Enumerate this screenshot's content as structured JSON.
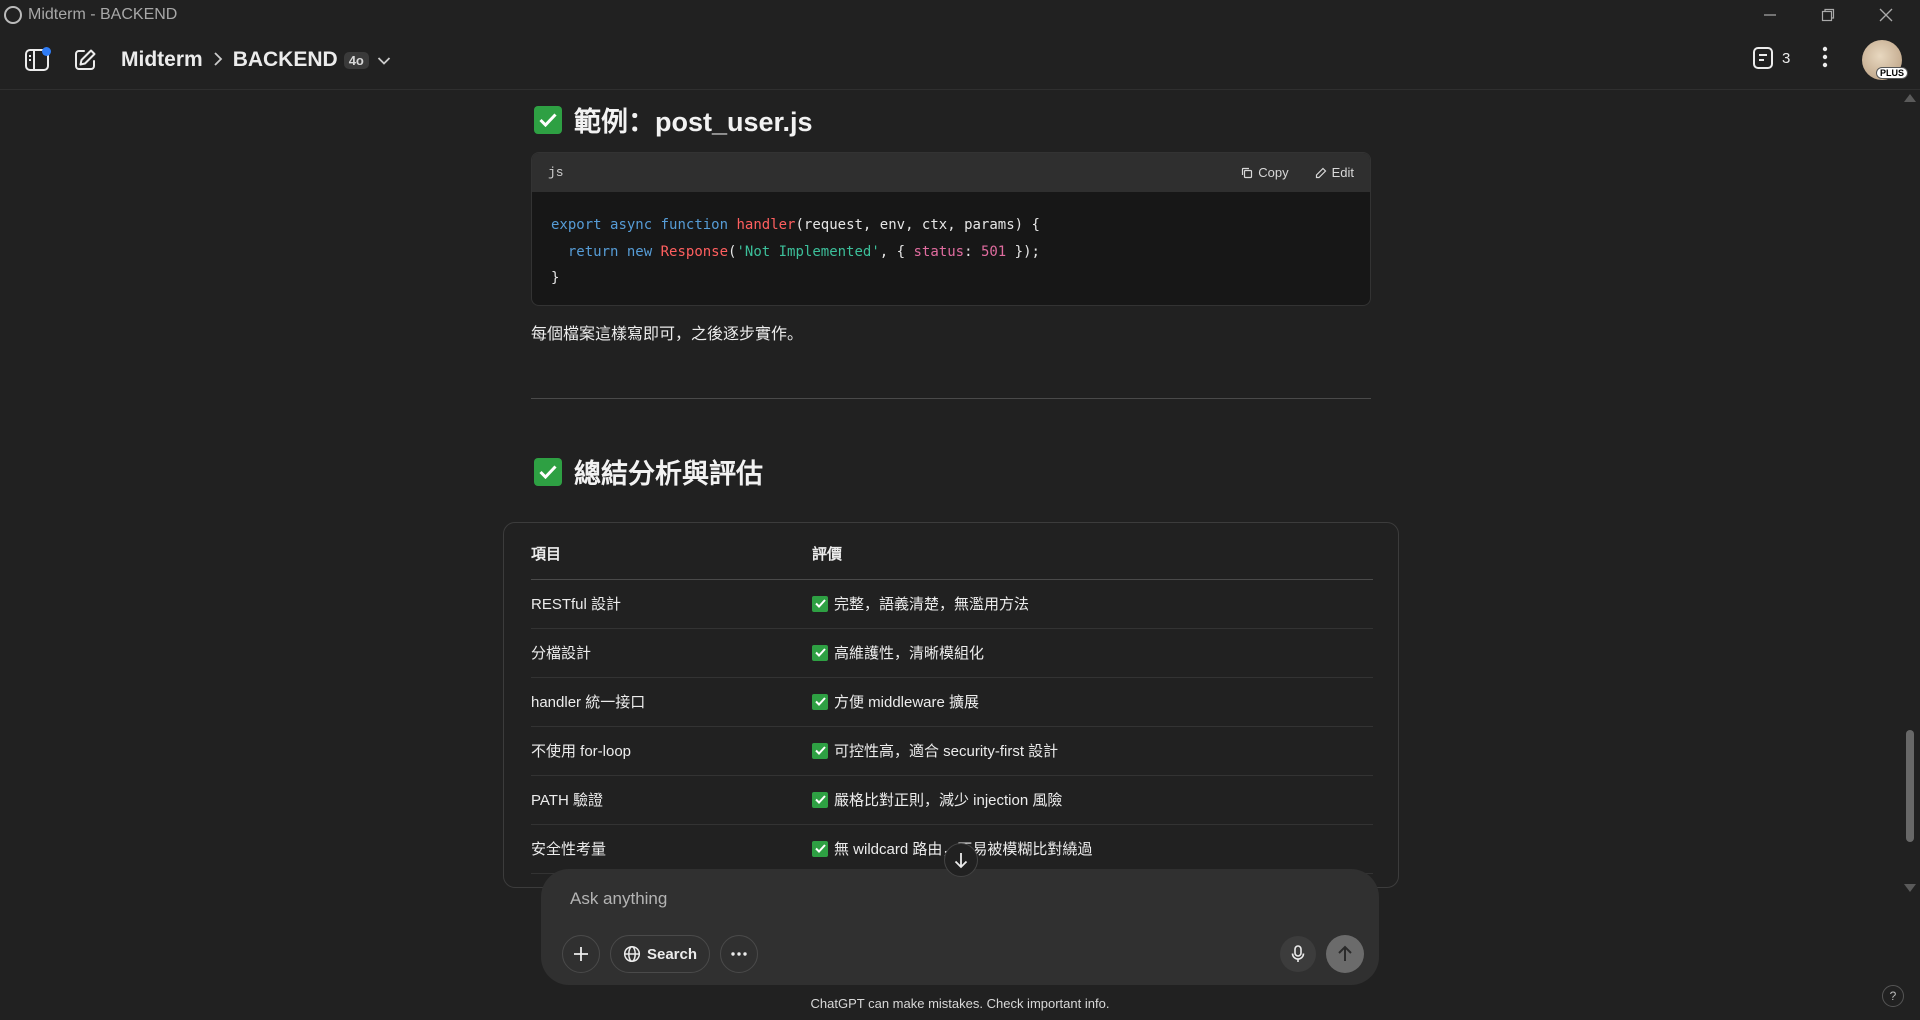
{
  "window": {
    "title": "Midterm - BACKEND"
  },
  "header": {
    "project": "Midterm",
    "chat": "BACKEND",
    "model_badge": "4o",
    "docs_count": "3",
    "plan_badge": "PLUS"
  },
  "section1": {
    "heading": "範例：post_user.js",
    "code": {
      "lang": "js",
      "copy_label": "Copy",
      "edit_label": "Edit",
      "line1": {
        "t1": "export",
        "t2": "async",
        "t3": "function",
        "t4": "handler",
        "t5": "(request, env, ctx, params) {"
      },
      "line2": {
        "t1": "return",
        "t2": "new",
        "t3": "Response",
        "t4": "(",
        "t5": "'Not Implemented'",
        "t6": ", { ",
        "t7": "status",
        "t8": ": ",
        "t9": "501",
        "t10": " });"
      },
      "line3": "}"
    },
    "note": "每個檔案這樣寫即可，之後逐步實作。"
  },
  "section2": {
    "heading": "總結分析與評估",
    "table": {
      "headers": [
        "項目",
        "評價"
      ],
      "rows": [
        {
          "item": "RESTful 設計",
          "eval": "完整，語義清楚，無濫用方法"
        },
        {
          "item": "分檔設計",
          "eval": "高維護性，清晰模組化"
        },
        {
          "item": "handler 統一接口",
          "eval": "方便 middleware 擴展"
        },
        {
          "item": "不使用 for-loop",
          "eval": "可控性高，適合 security-first 設計"
        },
        {
          "item": "PATH 驗證",
          "eval": "嚴格比對正則，減少 injection 風險"
        },
        {
          "item": "安全性考量",
          "eval": "無 wildcard 路由，不易被模糊比對繞過"
        }
      ]
    }
  },
  "composer": {
    "placeholder": "Ask anything",
    "search_label": "Search"
  },
  "footer": {
    "disclaimer": "ChatGPT can make mistakes. Check important info.",
    "help": "?"
  },
  "colors": {
    "background": "#212121",
    "check_green": "#2ea043",
    "accent_blue": "#2f7cf6"
  }
}
